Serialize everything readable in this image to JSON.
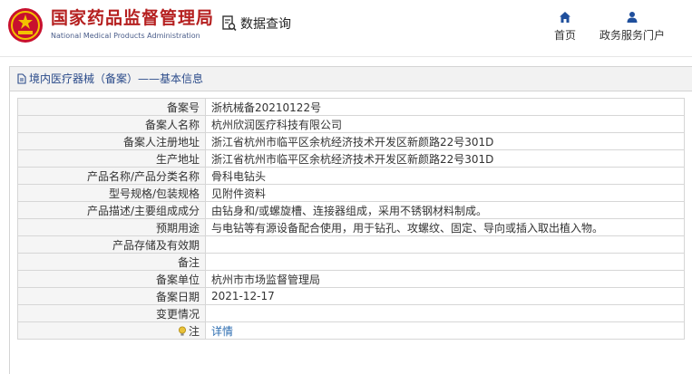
{
  "header": {
    "site_name": "国家药品监督管理局",
    "site_name_en": "National Medical Products Administration",
    "query_label": "数据查询",
    "nav": [
      {
        "label": "首页",
        "icon": "home-icon"
      },
      {
        "label": "政务服务门户",
        "icon": "user-icon"
      }
    ]
  },
  "panel": {
    "title": "境内医疗器械（备案）——基本信息",
    "rows": [
      {
        "key": "备案号",
        "value": "浙杭械备20210122号"
      },
      {
        "key": "备案人名称",
        "value": "杭州欣润医疗科技有限公司"
      },
      {
        "key": "备案人注册地址",
        "value": "浙江省杭州市临平区余杭经济技术开发区新颜路22号301D"
      },
      {
        "key": "生产地址",
        "value": "浙江省杭州市临平区余杭经济技术开发区新颜路22号301D"
      },
      {
        "key": "产品名称/产品分类名称",
        "value": "骨科电钻头"
      },
      {
        "key": "型号规格/包装规格",
        "value": "见附件资料"
      },
      {
        "key": "产品描述/主要组成成分",
        "value": "由钻身和/或螺旋槽、连接器组成，采用不锈钢材料制成。"
      },
      {
        "key": "预期用途",
        "value": "与电钻等有源设备配合使用，用于钻孔、攻螺纹、固定、导向或插入取出植入物。"
      },
      {
        "key": "产品存储及有效期",
        "value": ""
      },
      {
        "key": "备注",
        "value": ""
      },
      {
        "key": "备案单位",
        "value": "杭州市市场监督管理局"
      },
      {
        "key": "备案日期",
        "value": "2021-12-17"
      },
      {
        "key": "变更情况",
        "value": ""
      },
      {
        "key": "注",
        "value": "详情"
      }
    ]
  },
  "colors": {
    "brand_red": "#b51f1f",
    "link_blue": "#2b6cb0",
    "nav_blue": "#1f4f9c"
  }
}
